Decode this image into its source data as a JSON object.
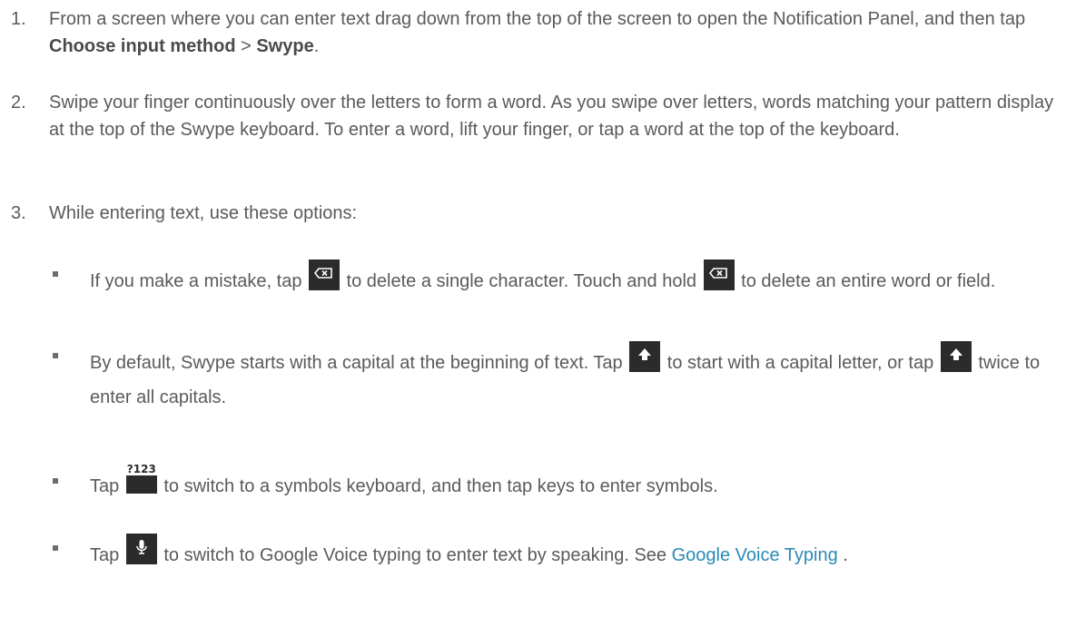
{
  "steps": [
    {
      "number": "1.",
      "text_a": "From a screen where you can enter text drag down from the top of the screen to open the Notification Panel, and then tap ",
      "bold_a": "Choose input method",
      "text_b": " > ",
      "bold_b": "Swype",
      "text_c": "."
    },
    {
      "number": "2.",
      "text": "Swipe your finger continuously over the letters to form a word. As you swipe over letters, words matching your pattern display at the top of the Swype keyboard. To enter a word, lift your finger, or tap a word at the top of the keyboard."
    },
    {
      "number": "3.",
      "text": "While entering text, use these options:"
    }
  ],
  "options": [
    {
      "text_a": "If you make a mistake, tap ",
      "text_b": " to delete a single character. Touch and hold ",
      "text_c": " to delete an entire word or field.",
      "icon": "backspace-key-icon"
    },
    {
      "text_a": "By default, Swype starts with a capital at the beginning of text. Tap ",
      "text_b": " to start with a capital letter, or tap ",
      "text_c": " twice to enter all capitals.",
      "icon": "shift-key-icon"
    },
    {
      "text_a": "Tap ",
      "key_label": "?123",
      "text_b": " to switch to a symbols keyboard, and then tap keys to enter symbols.",
      "icon": "symbols-key-icon"
    },
    {
      "text_a": "Tap ",
      "text_b": " to switch to Google Voice typing to enter text by speaking. See ",
      "link": "Google Voice Typing",
      "text_c": " .",
      "icon": "microphone-key-icon"
    }
  ],
  "colors": {
    "text": "#5a5a5a",
    "link": "#2a8ab8",
    "key_background": "#2b2b2b"
  }
}
